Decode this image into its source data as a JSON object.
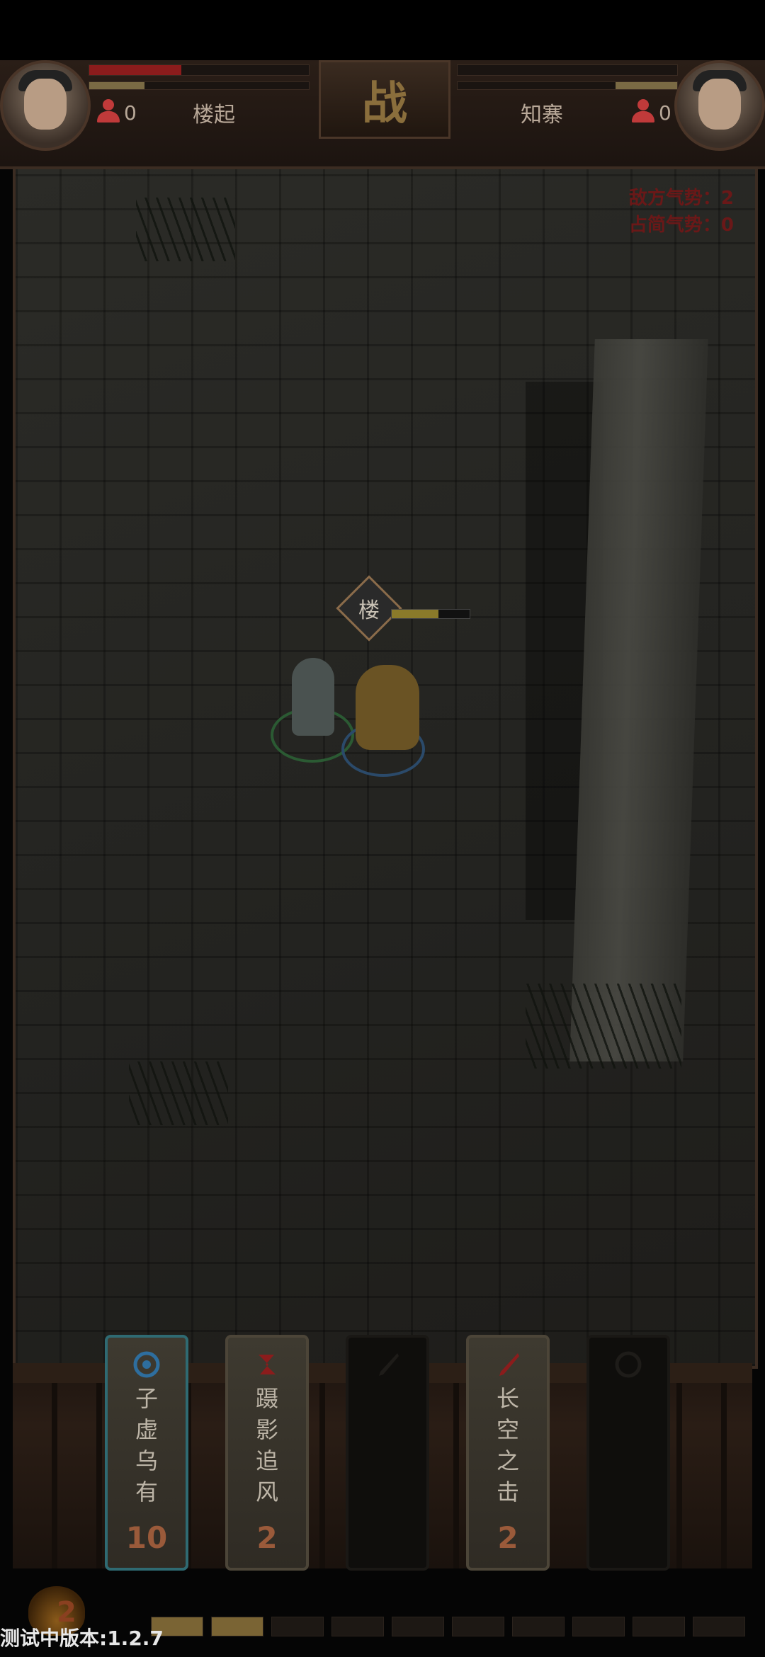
{
  "hud": {
    "battle_title": "战",
    "player": {
      "name": "楼起",
      "count": "0",
      "hp_fraction": 0.42,
      "energy_fraction": 0.25
    },
    "enemy": {
      "name": "知寨",
      "count": "0",
      "hp_fraction": 0.0,
      "energy_fraction": 0.28
    }
  },
  "battlefield": {
    "enemy_morale": "敌方气势：2",
    "occupy_morale": "占简气势：0",
    "unit_tag": "楼",
    "unit_hp_fraction": 0.6
  },
  "skills": [
    {
      "label": "子虚乌有",
      "cost": "10",
      "icon": "target-icon",
      "state": "active"
    },
    {
      "label": "蹑影追风",
      "cost": "2",
      "icon": "ribbon-icon",
      "state": "available"
    },
    {
      "label": "",
      "cost": "",
      "icon": "sword-icon",
      "state": "disabled"
    },
    {
      "label": "长空之击",
      "cost": "2",
      "icon": "sword-icon",
      "state": "available"
    },
    {
      "label": "",
      "cost": "",
      "icon": "target-icon",
      "state": "disabled"
    }
  ],
  "energy": {
    "value": "2",
    "slots_total": 10,
    "slots_filled": 2
  },
  "version_text": "测试中版本:1.2.7",
  "colors": {
    "hp_red": "#8b1c1c",
    "energy_yellow": "#7a6a44",
    "active_card_border": "#2f6a72"
  }
}
